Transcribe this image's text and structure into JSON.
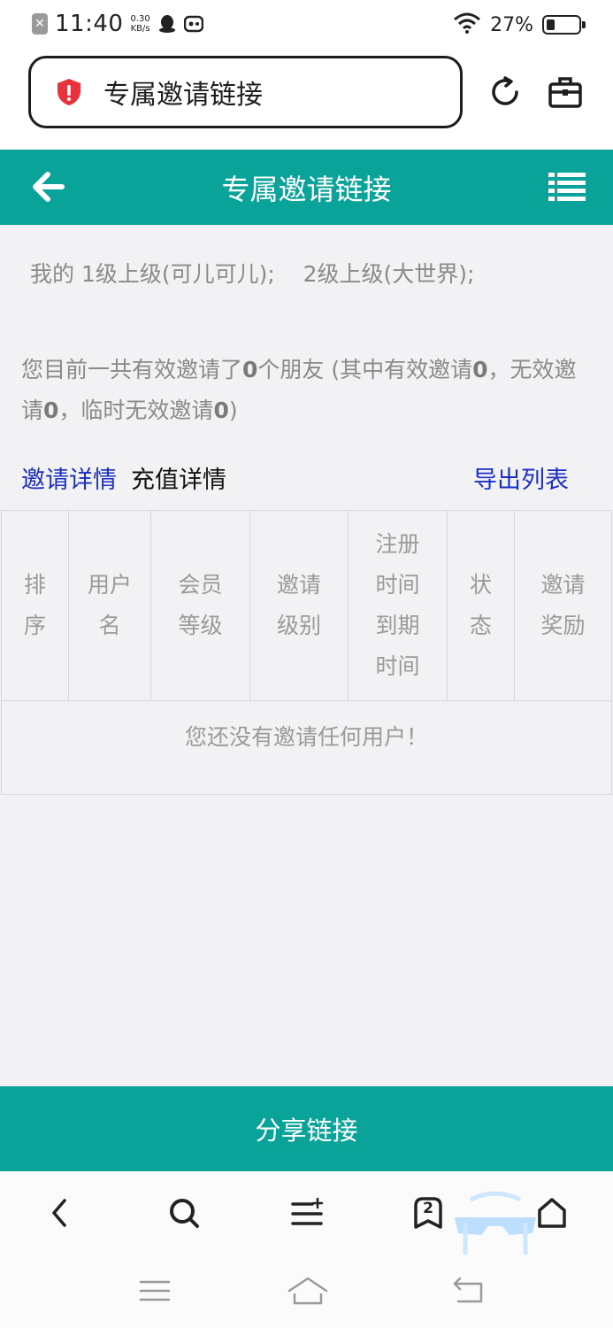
{
  "status_bar": {
    "time": "11:40",
    "speed_value": "0.30",
    "speed_unit": "KB/s",
    "battery": "27%",
    "battery_level": 0.27,
    "icons": [
      "close-notification-icon",
      "qq-penguin-icon",
      "game-controller-icon",
      "wifi-icon",
      "battery-icon"
    ]
  },
  "browser": {
    "url_title": "专属邀请链接",
    "icons": [
      "security-shield-icon",
      "refresh-icon",
      "toolbox-icon"
    ]
  },
  "header": {
    "title": "专属邀请链接",
    "icons": [
      "back-arrow-icon",
      "list-menu-icon"
    ]
  },
  "superior_info": "我的 1级上级(可儿可儿);    2级上级(大世界);",
  "invite_summary": {
    "t1": "您目前一共有效邀请了",
    "total": "0",
    "t2": "个朋友 (其中有效邀请",
    "valid": "0",
    "t3": "，无效邀请",
    "invalid": "0",
    "t4": "，临时无效邀请",
    "temp_invalid": "0",
    "t5": ")"
  },
  "tabs": {
    "invite_details": "邀请详情",
    "recharge_details": "充值详情",
    "export_list": "导出列表"
  },
  "table": {
    "headers": [
      "排\n序",
      "用户\n名",
      "会员\n等级",
      "邀请\n级别",
      "注册\n时间\n到期\n时间",
      "状\n态",
      "邀请\n奖励"
    ],
    "empty_message": "您还没有邀请任何用户！"
  },
  "share_button": "分享链接",
  "bottom_nav": {
    "tabs_count": "2",
    "icons": [
      "back-icon",
      "search-icon",
      "menu-list-icon",
      "tabs-icon",
      "home-icon"
    ]
  },
  "system_nav": {
    "icons": [
      "recents-icon",
      "home-nav-icon",
      "back-nav-icon"
    ]
  },
  "colors": {
    "accent": "#0aa39a",
    "link": "#1a2fc4",
    "muted_text": "#8a8a8a",
    "shield": "#e8323c"
  }
}
